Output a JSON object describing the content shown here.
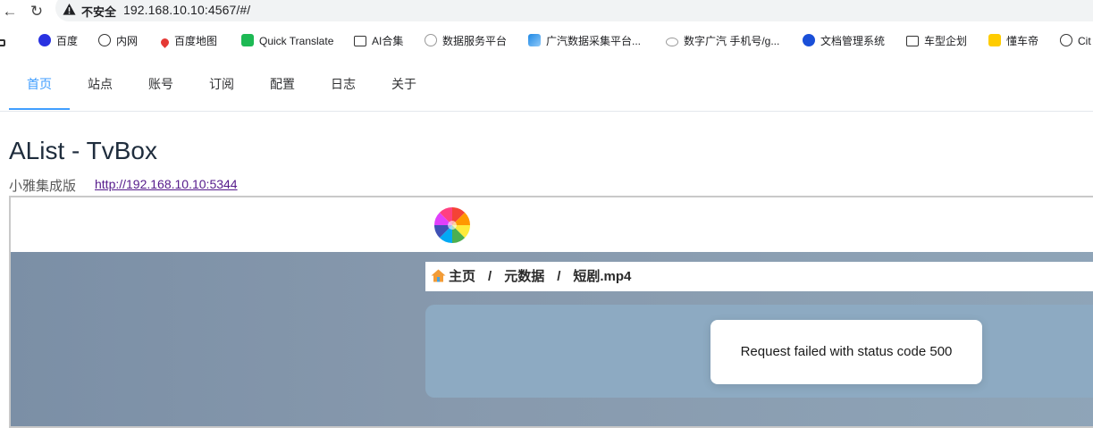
{
  "browser": {
    "insecure_label": "不安全",
    "url": "192.168.10.10:4567/#/"
  },
  "bookmarks": [
    {
      "label": "百度",
      "icon": "baidu-paw-icon"
    },
    {
      "label": "内网",
      "icon": "globe-icon"
    },
    {
      "label": "百度地图",
      "icon": "map-pin-icon"
    },
    {
      "label": "Quick Translate",
      "icon": "translate-icon"
    },
    {
      "label": "AI合集",
      "icon": "folder-icon"
    },
    {
      "label": "数据服务平台",
      "icon": "gear-icon"
    },
    {
      "label": "广汽数据采集平台...",
      "icon": "layers-icon"
    },
    {
      "label": "数字广汽 手机号/g...",
      "icon": "cloud-icon"
    },
    {
      "label": "文档管理系统",
      "icon": "doc-system-icon"
    },
    {
      "label": "车型企划",
      "icon": "folder-icon"
    },
    {
      "label": "懂车帝",
      "icon": "dongchedi-icon"
    },
    {
      "label": "Cit",
      "icon": "spiral-icon"
    }
  ],
  "tabs": [
    {
      "label": "首页",
      "active": true
    },
    {
      "label": "站点"
    },
    {
      "label": "账号"
    },
    {
      "label": "订阅"
    },
    {
      "label": "配置"
    },
    {
      "label": "日志"
    },
    {
      "label": "关于"
    }
  ],
  "page": {
    "title": "AList - TvBox",
    "subtitle": "小雅集成版",
    "link": "http://192.168.10.10:5344"
  },
  "frame": {
    "breadcrumb": [
      "主页",
      "元数据",
      "短剧.mp4"
    ],
    "breadcrumb_sep": "/",
    "error_message": "Request failed with status code 500"
  },
  "colors": {
    "accent": "#409eff",
    "link_visited": "#551a8b",
    "frame_background": "#8799ad"
  }
}
